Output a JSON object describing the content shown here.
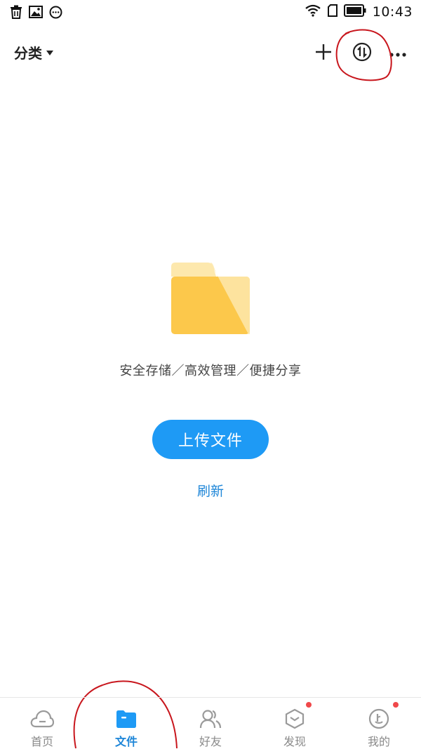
{
  "status_bar": {
    "time": "10:43",
    "left_icons": [
      "trash-icon",
      "image-icon",
      "chat-bubble-icon"
    ],
    "right_icons": [
      "wifi-icon",
      "sim-icon",
      "battery-icon"
    ]
  },
  "header": {
    "title": "分类",
    "actions": [
      "add-icon",
      "transfer-icon",
      "more-icon"
    ]
  },
  "empty_state": {
    "illustration": "folder-illustration",
    "tagline": "安全存储／高效管理／便捷分享",
    "upload_label": "上传文件",
    "refresh_label": "刷新"
  },
  "bottom_nav": {
    "items": [
      {
        "label": "首页",
        "icon": "cloud-icon",
        "active": false,
        "badge": false
      },
      {
        "label": "文件",
        "icon": "folder-icon",
        "active": true,
        "badge": false
      },
      {
        "label": "好友",
        "icon": "friends-icon",
        "active": false,
        "badge": false
      },
      {
        "label": "发现",
        "icon": "discover-icon",
        "active": false,
        "badge": true
      },
      {
        "label": "我的",
        "icon": "profile-icon",
        "active": false,
        "badge": true
      }
    ]
  },
  "colors": {
    "accent": "#1e9af5",
    "link": "#1e86d8",
    "folder_light": "#fde8ad",
    "folder_main": "#fcc84b",
    "badge": "#f0484a",
    "annotation": "#c8161d"
  }
}
